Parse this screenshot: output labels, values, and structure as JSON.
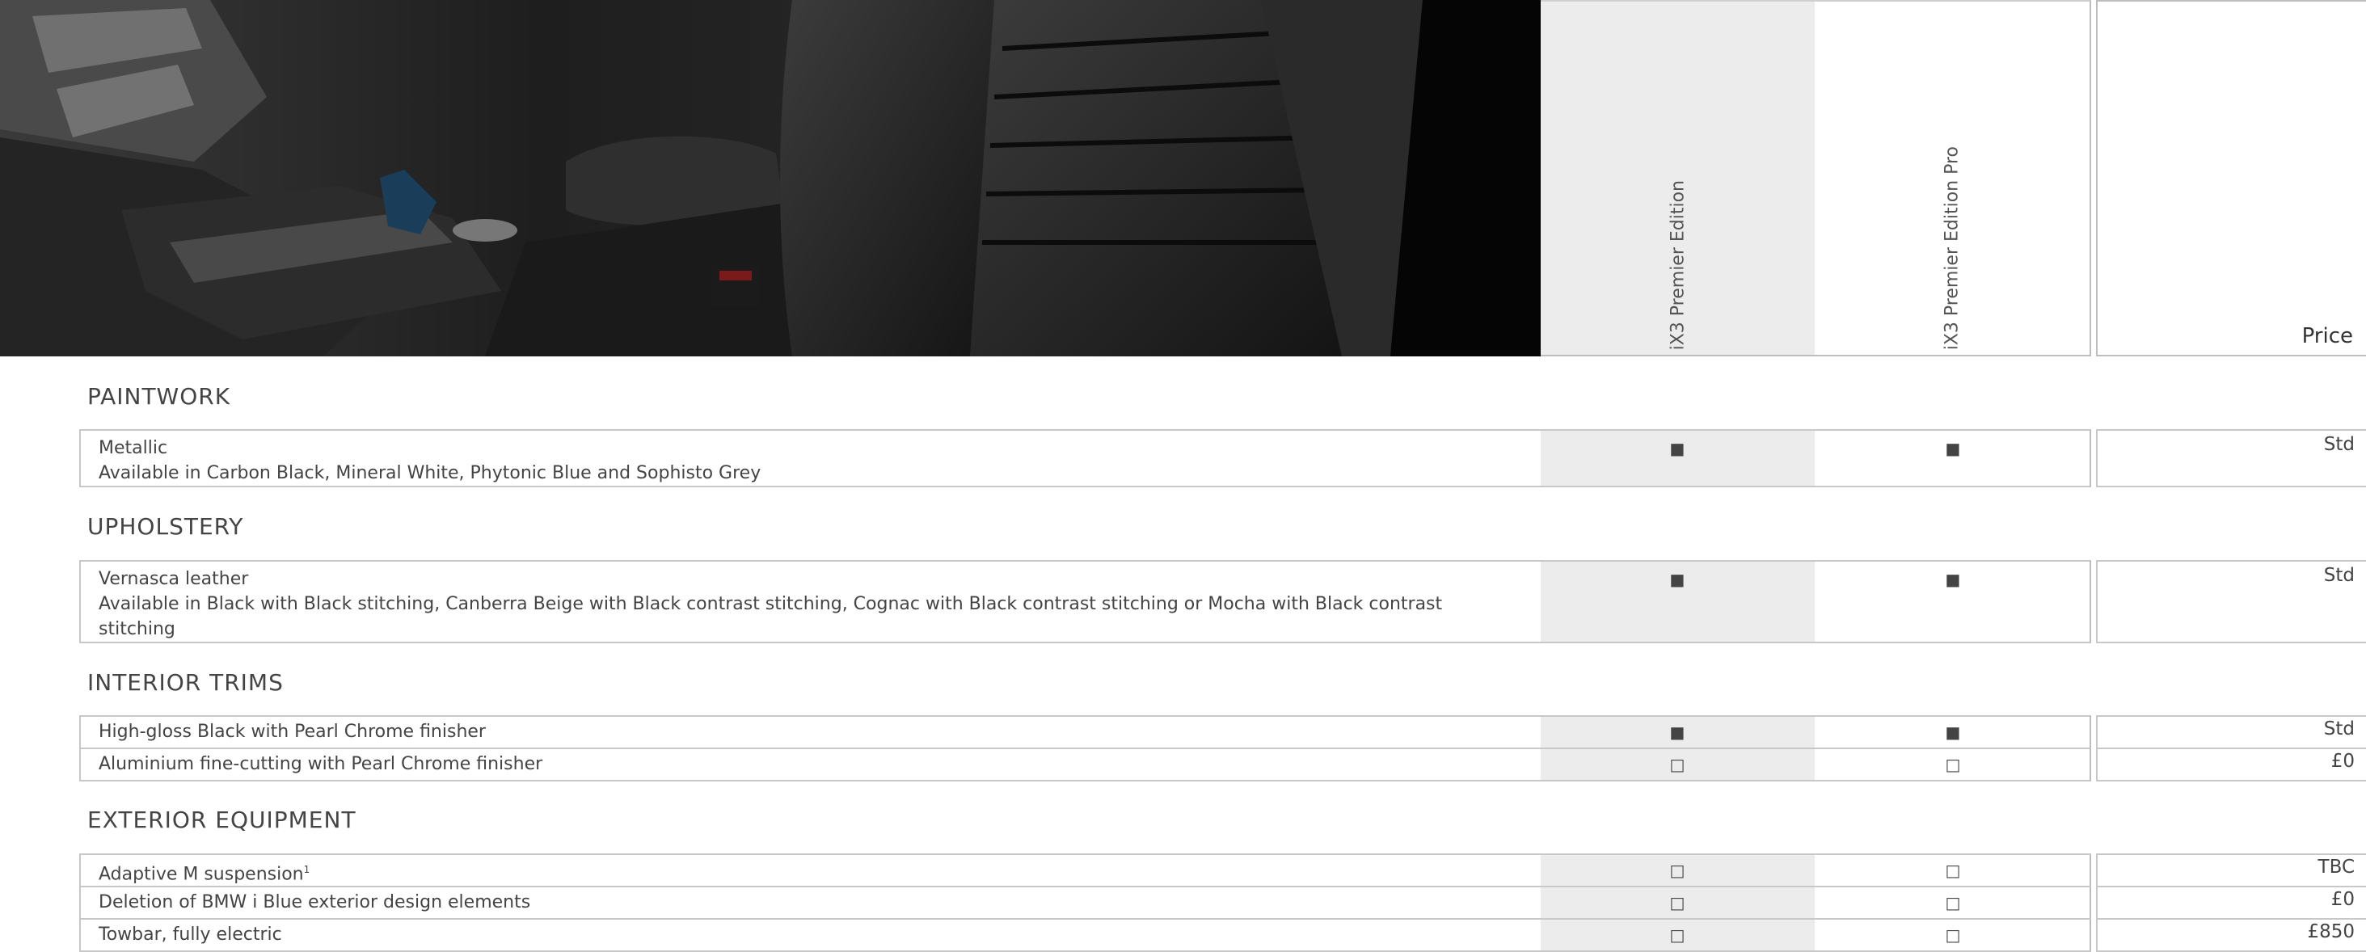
{
  "columns": {
    "col1": "iX3 Premier Edition",
    "col2": "iX3 Premier Edition Pro",
    "price": "Price"
  },
  "icons": {
    "standard": "filled-square",
    "optional": "hollow-square"
  },
  "sections": [
    {
      "title": "PAINTWORK",
      "rows": [
        {
          "name": "Metallic",
          "desc": "Available in Carbon Black, Mineral White, Phytonic Blue and Sophisto Grey",
          "col1": "■",
          "col2": "■",
          "price": "Std"
        }
      ]
    },
    {
      "title": "UPHOLSTERY",
      "rows": [
        {
          "name": "Vernasca leather",
          "desc": "Available in Black with Black stitching, Canberra Beige with Black contrast stitching, Cognac with Black contrast stitching or Mocha with Black contrast stitching",
          "col1": "■",
          "col2": "■",
          "price": "Std"
        }
      ]
    },
    {
      "title": "INTERIOR TRIMS",
      "rows": [
        {
          "name": "High-gloss Black with Pearl Chrome finisher",
          "col1": "■",
          "col2": "■",
          "price": "Std"
        },
        {
          "name": "Aluminium fine-cutting with Pearl Chrome finisher",
          "col1": "□",
          "col2": "□",
          "price": "£0"
        }
      ]
    },
    {
      "title": "EXTERIOR EQUIPMENT",
      "rows": [
        {
          "name": "Adaptive M suspension",
          "footnote": "1",
          "col1": "□",
          "col2": "□",
          "price": "TBC"
        },
        {
          "name": "Deletion of BMW i Blue exterior design elements",
          "col1": "□",
          "col2": "□",
          "price": "£0"
        },
        {
          "name": "Towbar, fully electric",
          "col1": "□",
          "col2": "□",
          "price": "£850"
        }
      ]
    }
  ]
}
